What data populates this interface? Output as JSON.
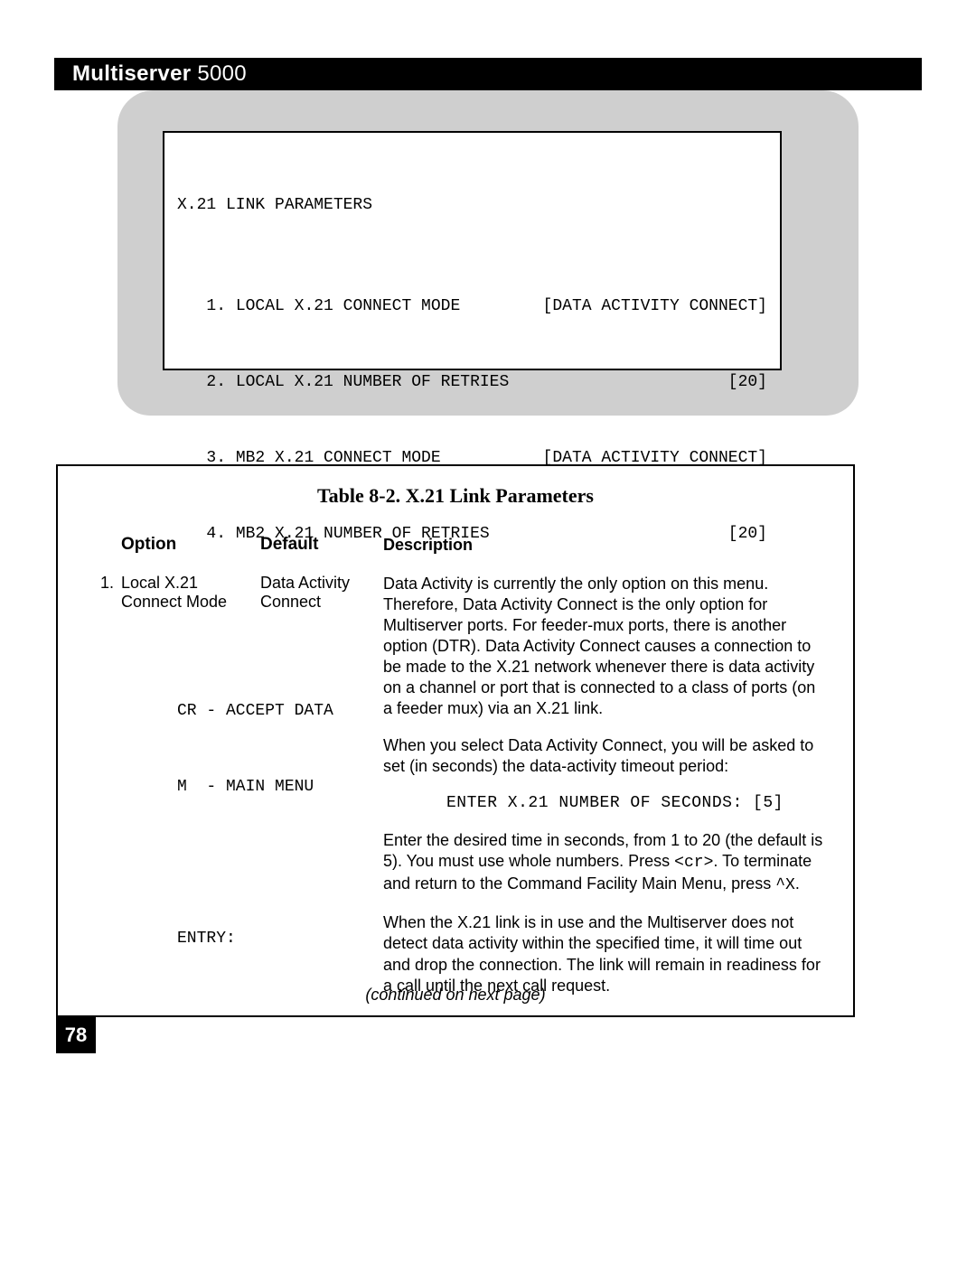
{
  "header": {
    "brand": "Multiserver",
    "model": "5000"
  },
  "terminal": {
    "title": "X.21 LINK PARAMETERS",
    "items": [
      {
        "n": "1",
        "label": "LOCAL X.21 CONNECT MODE",
        "value": "[DATA ACTIVITY CONNECT]"
      },
      {
        "n": "2",
        "label": "LOCAL X.21 NUMBER OF RETRIES",
        "value": "[20]"
      },
      {
        "n": "3",
        "label": "MB2 X.21 CONNECT MODE",
        "value": "[DATA ACTIVITY CONNECT]"
      },
      {
        "n": "4",
        "label": "MB2 X.21 NUMBER OF RETRIES",
        "value": "[20]"
      }
    ],
    "footer": [
      "CR - ACCEPT DATA",
      "M  - MAIN MENU"
    ],
    "prompt": "ENTRY:"
  },
  "table": {
    "title": "Table 8-2. X.21 Link Parameters",
    "headers": {
      "option": "Option",
      "default": "Default",
      "description": "Description"
    },
    "row": {
      "num": "1.",
      "option": "Local X.21 Connect Mode",
      "default": "Data Activity Connect",
      "desc": {
        "p1": "Data Activity is currently the only option on this menu. Therefore, Data Activity Connect is the only option for Multiserver ports. For feeder-mux ports, there is another option (DTR). Data Activity Connect causes a connection to be made to the X.21 network whenever there is data activity on a channel or port that is connected to a class of ports (on a feeder mux) via an X.21 link.",
        "p2": "When you select Data Activity Connect, you will be asked to set (in seconds) the data-activity timeout period:",
        "monoline": "ENTER X.21 NUMBER OF SECONDS: [5]",
        "p3a": "Enter the desired time in seconds, from 1 to 20 (the default is 5). You must use whole numbers. Press ",
        "p3cr": "<cr>",
        "p3b": ". To terminate and return to the Command Facility Main Menu, press ",
        "p3x": "^X",
        "p3c": ".",
        "p4": "When the X.21 link is in use and the Multiserver does not detect data activity within the specified time, it will time out and drop the connection. The link will remain in readiness for a call until the next call request."
      }
    },
    "continued": "(continued on next page)"
  },
  "page_number": "78",
  "chart_data": {
    "type": "table",
    "title": "Table 8-2. X.21 Link Parameters",
    "columns": [
      "Option",
      "Default",
      "Description"
    ],
    "rows": [
      {
        "Option": "1. Local X.21 Connect Mode",
        "Default": "Data Activity Connect",
        "Description": "Data Activity is the only option for Multiserver ports (DTR also available for feeder-mux ports). Causes connection to the X.21 network on data activity. Prompts ENTER X.21 NUMBER OF SECONDS: [5]; valid range 1–20, default 5. Press <cr> to accept, ^X to return to Main Menu. Link times out and drops when no data activity detected within the specified time; remains ready for next call."
      }
    ],
    "terminal_menu": {
      "title": "X.21 LINK PARAMETERS",
      "options": [
        {
          "id": 1,
          "name": "LOCAL X.21 CONNECT MODE",
          "value": "DATA ACTIVITY CONNECT"
        },
        {
          "id": 2,
          "name": "LOCAL X.21 NUMBER OF RETRIES",
          "value": 20
        },
        {
          "id": 3,
          "name": "MB2 X.21 CONNECT MODE",
          "value": "DATA ACTIVITY CONNECT"
        },
        {
          "id": 4,
          "name": "MB2 X.21 NUMBER OF RETRIES",
          "value": 20
        }
      ],
      "commands": {
        "CR": "ACCEPT DATA",
        "M": "MAIN MENU"
      }
    }
  }
}
